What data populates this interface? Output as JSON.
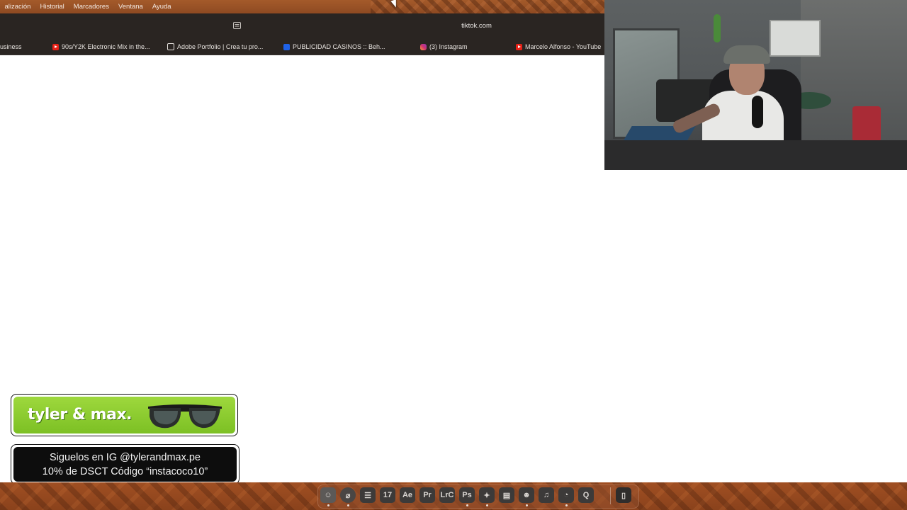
{
  "menubar": {
    "items": [
      "alización",
      "Historial",
      "Marcadores",
      "Ventana",
      "Ayuda"
    ]
  },
  "browser": {
    "url": "tiktok.com",
    "bookmarks": [
      {
        "label": "usiness",
        "icon": "none"
      },
      {
        "label": "90s/Y2K Electronic Mix in the...",
        "icon": "youtube-icon"
      },
      {
        "label": "Adobe Portfolio | Crea tu pro...",
        "icon": "adobe-portfolio-icon"
      },
      {
        "label": "PUBLICIDAD CASINOS :: Beh...",
        "icon": "behance-icon"
      },
      {
        "label": "(3) Instagram",
        "icon": "instagram-icon"
      },
      {
        "label": "Marcelo Alfonso - YouTube",
        "icon": "youtube-icon"
      }
    ]
  },
  "sponsor": {
    "brand": "tyler & max.",
    "line1": "Siguelos en IG @tylerandmax.pe",
    "line2": "10% de DSCT Código “instacoco10”"
  },
  "dock": {
    "icons": [
      {
        "name": "finder-icon",
        "glyph": "☺"
      },
      {
        "name": "safari-icon",
        "glyph": "⌀"
      },
      {
        "name": "launchpad-icon",
        "glyph": "☰"
      },
      {
        "name": "calendar-icon",
        "glyph": "17"
      },
      {
        "name": "after-effects-icon",
        "glyph": "Ae"
      },
      {
        "name": "premiere-pro-icon",
        "glyph": "Pr"
      },
      {
        "name": "lightroom-classic-icon",
        "glyph": "LrC"
      },
      {
        "name": "photoshop-icon",
        "glyph": "Ps"
      },
      {
        "name": "tailscale-icon",
        "glyph": "✦"
      },
      {
        "name": "keynote-icon",
        "glyph": "▤"
      },
      {
        "name": "discord-icon",
        "glyph": "☻"
      },
      {
        "name": "music-icon",
        "glyph": "♫"
      },
      {
        "name": "activity-monitor-icon",
        "glyph": "◔"
      },
      {
        "name": "quicktime-icon",
        "glyph": "Q"
      },
      {
        "name": "trash-icon",
        "glyph": "▯"
      }
    ]
  },
  "colors": {
    "menubar": "#9a5227",
    "browser_chrome": "#2a2522",
    "sponsor_green": "#8ccc2e",
    "promo_black": "#0d0d0d"
  }
}
